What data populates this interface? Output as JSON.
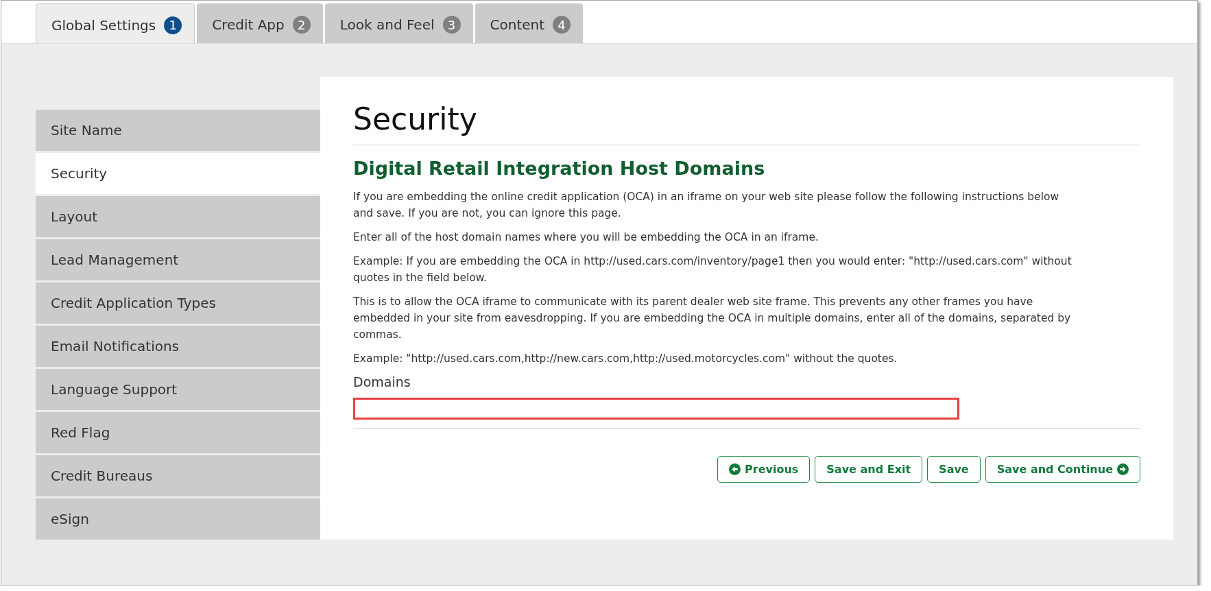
{
  "tabs": [
    {
      "label": "Global Settings",
      "number": "1",
      "selected": true
    },
    {
      "label": "Credit App",
      "number": "2",
      "selected": false
    },
    {
      "label": "Look and Feel",
      "number": "3",
      "selected": false
    },
    {
      "label": "Content",
      "number": "4",
      "selected": false
    }
  ],
  "sidebar": {
    "items": [
      {
        "label": "Site Name",
        "selected": false
      },
      {
        "label": "Security",
        "selected": true
      },
      {
        "label": "Layout",
        "selected": false
      },
      {
        "label": "Lead Management",
        "selected": false
      },
      {
        "label": "Credit Application Types",
        "selected": false
      },
      {
        "label": "Email Notifications",
        "selected": false
      },
      {
        "label": "Language Support",
        "selected": false
      },
      {
        "label": "Red Flag",
        "selected": false
      },
      {
        "label": "Credit Bureaus",
        "selected": false
      },
      {
        "label": "eSign",
        "selected": false
      }
    ]
  },
  "page_title": "Security",
  "section_heading": "Digital Retail Integration Host Domains",
  "paragraphs": [
    "If you are embedding the online credit application (OCA) in an iframe on your web site please follow the following instructions below and save. If you are not, you can ignore this page.",
    "Enter all of the host domain names where you will be embedding the OCA in an iframe.",
    "Example: If you are embedding the OCA in http://used.cars.com/inventory/page1 then you would enter: \"http://used.cars.com\" without quotes in the field below.",
    "This is to allow the OCA iframe to communicate with its parent dealer web site frame. This prevents any other frames you have embedded in your site from eavesdropping. If you are embedding the OCA in multiple domains, enter all of the domains, separated by commas.",
    "Example: \"http://used.cars.com,http://new.cars.com,http://used.motorcycles.com\" without the quotes."
  ],
  "domains_field": {
    "label": "Domains",
    "highlighted": true
  },
  "buttons": [
    {
      "label": "Previous",
      "kind": "back"
    },
    {
      "label": "Save and Exit",
      "kind": "plain"
    },
    {
      "label": "Save",
      "kind": "plain"
    },
    {
      "label": "Save and Continue",
      "kind": "next"
    }
  ]
}
